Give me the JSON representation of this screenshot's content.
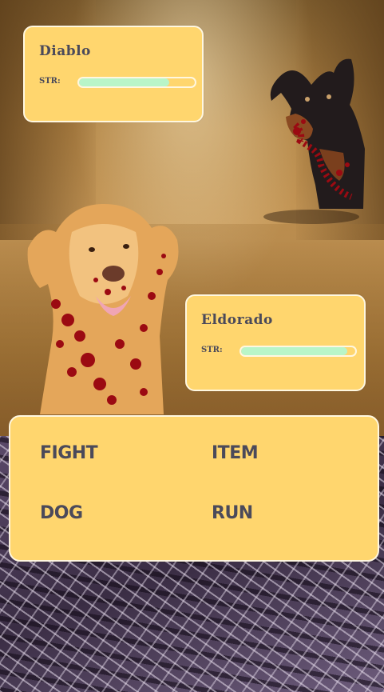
{
  "enemy": {
    "name": "Diablo",
    "str_label": "STR:",
    "str_fraction": 0.78
  },
  "player": {
    "name": "Eldorado",
    "str_label": "STR:",
    "str_fraction": 0.93
  },
  "menu": {
    "fight": "FIGHT",
    "item": "ITEM",
    "dog": "DOG",
    "run": "RUN"
  },
  "colors": {
    "panel": "#ffd66e",
    "panel_border": "#fff7e0",
    "bar_fill": "#b9f5c8",
    "text": "#4b4a5a",
    "blood": "#9b0a12"
  },
  "sprites": {
    "enemy_sprite": "doberman-dog-icon",
    "player_sprite": "golden-retriever-dog-icon"
  }
}
